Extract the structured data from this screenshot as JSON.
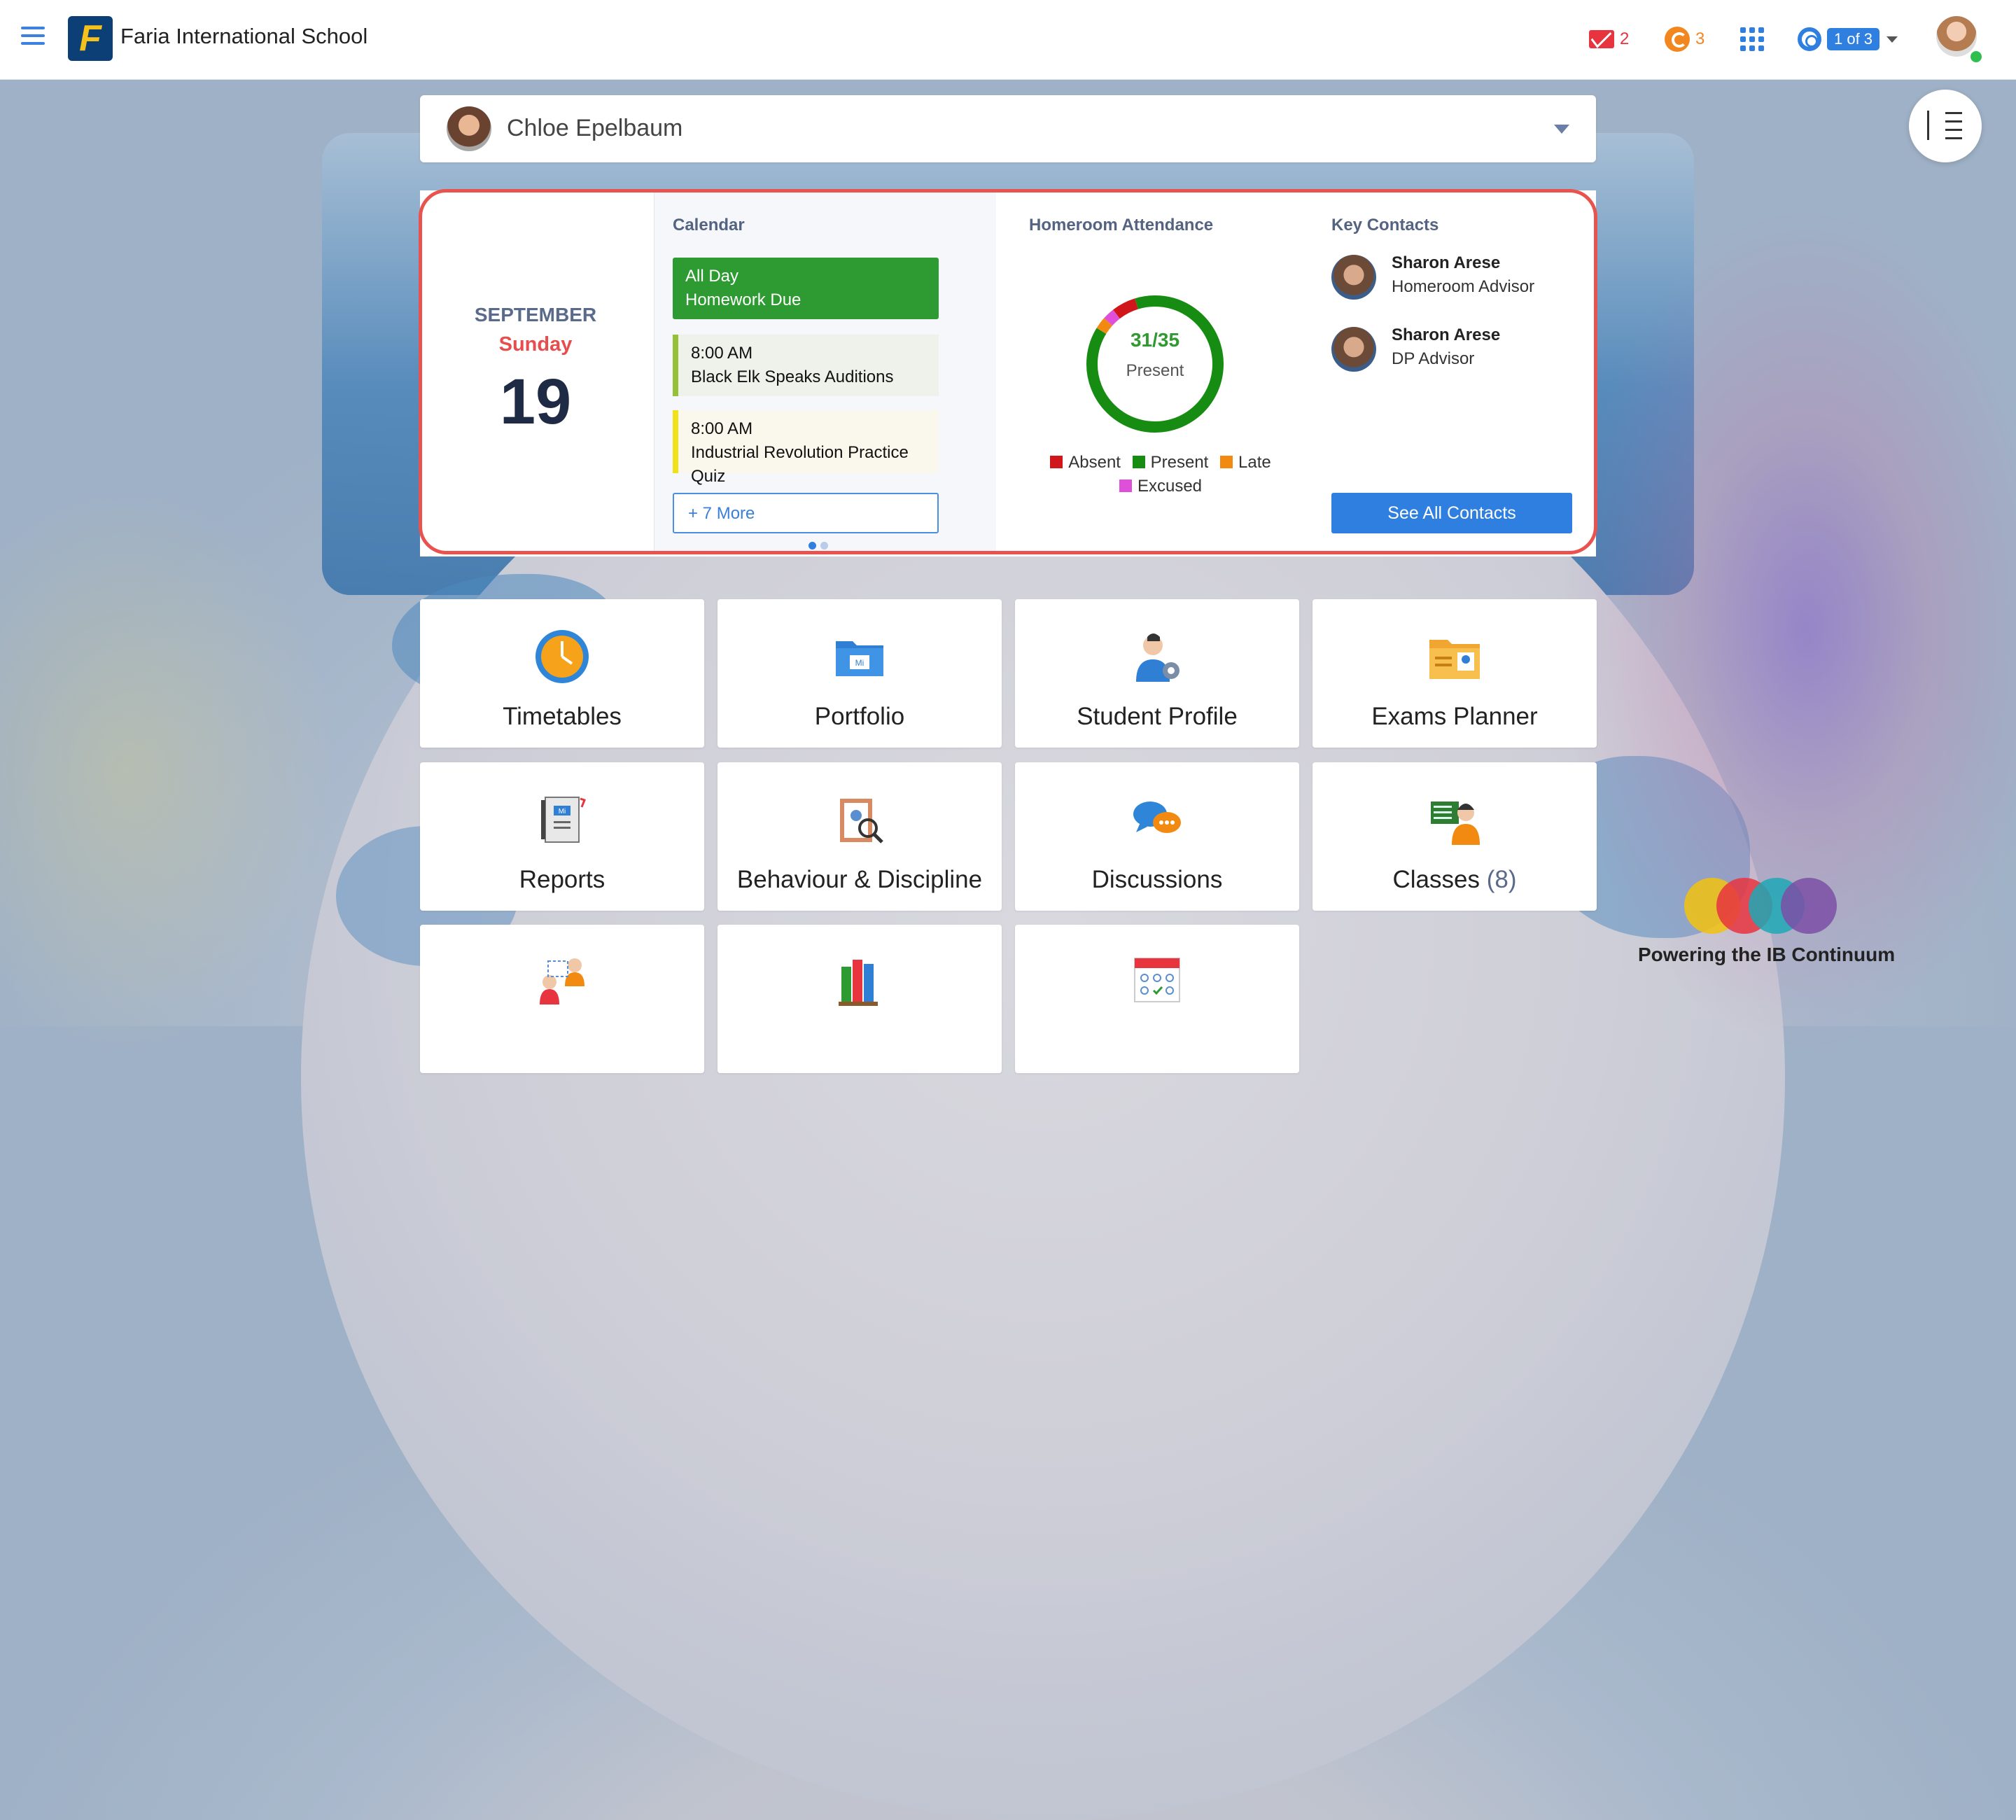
{
  "topbar": {
    "school_name": "Faria International School",
    "logo_letter": "F",
    "mail_count": "2",
    "notifications_count": "3",
    "page_indicator": "1 of 3",
    "colors": {
      "mail": "#e8343f",
      "notify": "#f2871f",
      "accent": "#2f7fe0"
    }
  },
  "student_selector": {
    "name": "Chloe Epelbaum"
  },
  "date_panel": {
    "month": "SEPTEMBER",
    "weekday": "Sunday",
    "day": "19"
  },
  "calendar": {
    "title": "Calendar",
    "events": [
      {
        "time": "All Day",
        "title": "Homework Due"
      },
      {
        "time": "8:00 AM",
        "title": "Black Elk Speaks Auditions"
      },
      {
        "time": "8:00 AM",
        "title": "Industrial Revolution Practice Quiz"
      }
    ],
    "more_label": "+ 7 More"
  },
  "attendance": {
    "title": "Homeroom Attendance",
    "count": "31/35",
    "count_label": "Present",
    "chart_data": {
      "type": "pie",
      "labels": [
        "Absent",
        "Present",
        "Late",
        "Excused"
      ],
      "values": [
        2,
        31,
        1,
        1
      ],
      "colors": [
        "#d0161b",
        "#168d12",
        "#f28a12",
        "#e04fd9"
      ]
    },
    "legend": [
      "Absent",
      "Present",
      "Late",
      "Excused"
    ]
  },
  "contacts": {
    "title": "Key Contacts",
    "items": [
      {
        "name": "Sharon Arese",
        "role": "Homeroom Advisor"
      },
      {
        "name": "Sharon Arese",
        "role": "DP Advisor"
      }
    ],
    "button_label": "See All Contacts"
  },
  "tiles": {
    "timetables": "Timetables",
    "portfolio": "Portfolio",
    "student_profile": "Student Profile",
    "exams_planner": "Exams Planner",
    "reports": "Reports",
    "behaviour": "Behaviour & Discipline",
    "discussions": "Discussions",
    "classes": "Classes",
    "classes_count": "(8)"
  },
  "branding": {
    "tagline": "Powering the IB Continuum"
  }
}
